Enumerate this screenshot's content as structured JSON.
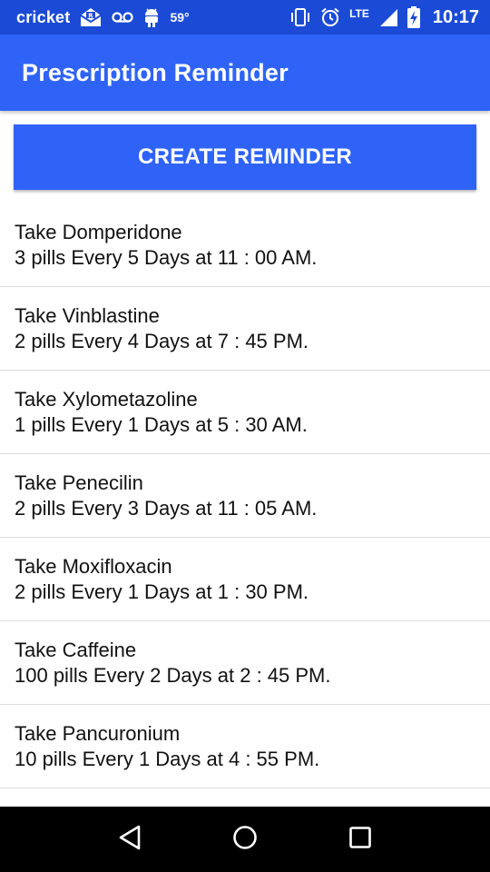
{
  "status_bar": {
    "carrier": "cricket",
    "temperature": "59°",
    "network": "LTE",
    "time": "10:17",
    "icons": [
      "envelope-icon",
      "voicemail-icon",
      "android-icon",
      "vibrate-icon",
      "alarm-icon",
      "signal-icon",
      "battery-charging-icon"
    ]
  },
  "app_bar": {
    "title": "Prescription Reminder"
  },
  "create_button": {
    "label": "CREATE REMINDER"
  },
  "reminders": [
    {
      "title": "Take Domperidone",
      "detail": "3 pills Every 5 Days at 11 : 00 AM."
    },
    {
      "title": "Take Vinblastine",
      "detail": "2 pills Every 4 Days at 7 : 45 PM."
    },
    {
      "title": "Take Xylometazoline",
      "detail": "1 pills Every 1 Days at 5 : 30 AM."
    },
    {
      "title": "Take Penecilin",
      "detail": "2 pills Every 3 Days at 11 : 05 AM."
    },
    {
      "title": "Take Moxifloxacin",
      "detail": "2 pills Every 1 Days at 1 : 30 PM."
    },
    {
      "title": "Take Caffeine",
      "detail": "100 pills Every 2 Days at 2 : 45 PM."
    },
    {
      "title": "Take Pancuronium",
      "detail": "10 pills Every 1 Days at 4 : 55 PM."
    }
  ],
  "nav_bar": {
    "icons": [
      "back-icon",
      "home-icon",
      "recents-icon"
    ]
  },
  "colors": {
    "status_bar": "#1b4bd6",
    "primary": "#2f63f7",
    "nav_bar": "#000000"
  }
}
